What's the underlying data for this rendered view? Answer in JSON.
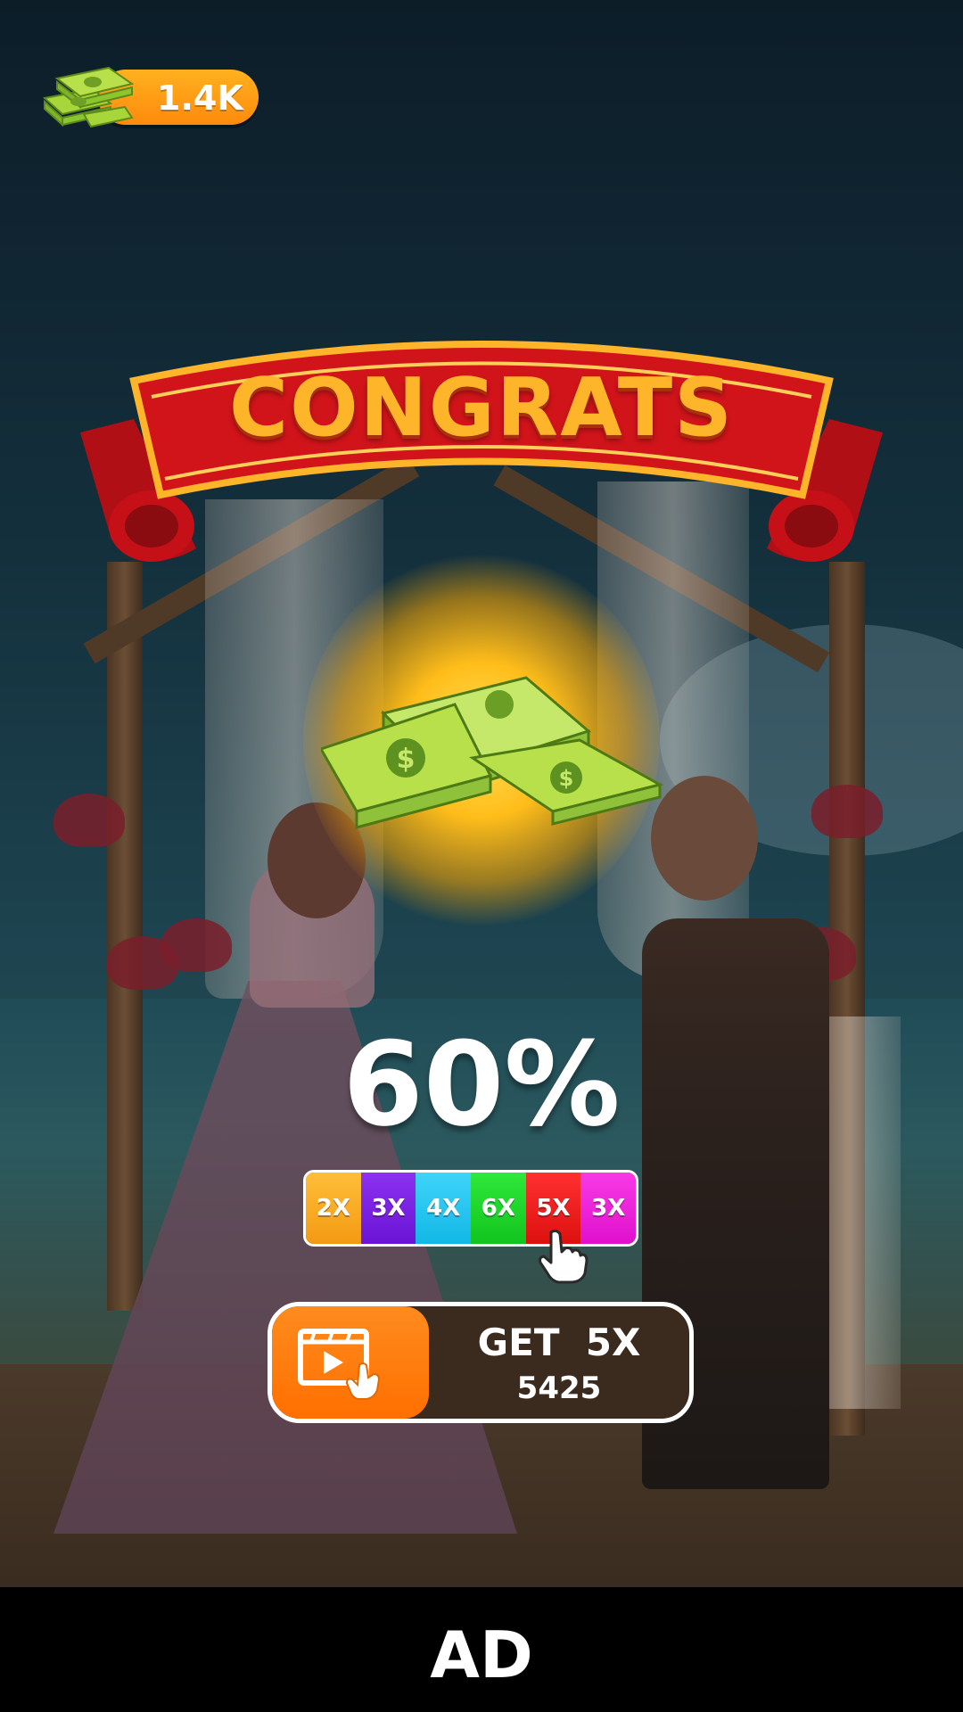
{
  "currency": {
    "amount": "1.4K",
    "icon": "cash-stack-icon",
    "pill_color": "#ff9a12"
  },
  "banner": {
    "title": "CONGRATS",
    "ribbon_color": "#d0141a",
    "text_color": "#ffb52a"
  },
  "reward": {
    "icon": "money-pile-icon",
    "glow_color": "#ffcc22"
  },
  "progress": {
    "percent_label": "60%"
  },
  "multiplier": {
    "segments": [
      {
        "label": "2X",
        "color": "#f5a623"
      },
      {
        "label": "3X",
        "color": "#7a1ee6"
      },
      {
        "label": "4X",
        "color": "#19c6f0"
      },
      {
        "label": "6X",
        "color": "#18d424"
      },
      {
        "label": "5X",
        "color": "#f01c1c"
      },
      {
        "label": "3X",
        "color": "#ee1ed8"
      }
    ],
    "selected": "5X",
    "pointer_icon": "hand-pointer-icon"
  },
  "claim_button": {
    "label": "GET  5X",
    "amount": "5425",
    "icon": "watch-video-icon",
    "accent": "#ff7a0a"
  },
  "ad_banner": {
    "label": "AD"
  }
}
